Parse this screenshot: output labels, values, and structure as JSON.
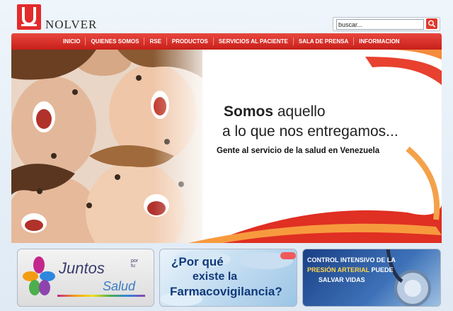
{
  "brand": {
    "name": "NOLVER",
    "logo_icon": "nolver-logo-icon"
  },
  "search": {
    "placeholder": "buscar...",
    "value": "buscar...",
    "button_icon": "search-icon"
  },
  "nav": {
    "items": [
      {
        "label": "INICIO"
      },
      {
        "label": "QUIENES SOMOS"
      },
      {
        "label": "RSE"
      },
      {
        "label": "PRODUCTOS"
      },
      {
        "label": "SERVICIOS AL PACIENTE"
      },
      {
        "label": "SALA DE PRENSA"
      },
      {
        "label": "INFORMACION"
      }
    ]
  },
  "banner": {
    "slogan_strong": "Somos",
    "slogan_rest": " aquello",
    "slogan_line2": "a lo que nos entregamos...",
    "tagline": "Gente al servicio de la salud en Venezuela"
  },
  "promos": {
    "juntos": {
      "word1": "Juntos",
      "por_tu": "por tu",
      "word2": "Salud"
    },
    "farmaco": {
      "line1": "¿Por qué",
      "line2": "existe la",
      "line3": "Farmacovigilancia?"
    },
    "presion": {
      "line1": "CONTROL INTENSIVO DE LA",
      "highlight": "PRESIÓN ARTERIAL",
      "after_highlight": " PUEDE",
      "line3": "SALVAR VIDAS"
    }
  },
  "colors": {
    "accent": "#e32b2b",
    "nav_red": "#c81f1a",
    "navy": "#123a7a"
  }
}
